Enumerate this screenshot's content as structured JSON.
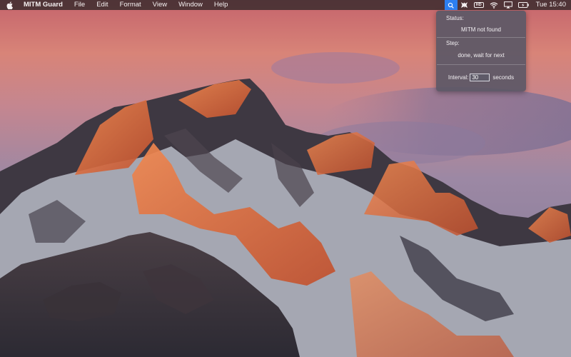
{
  "menubar": {
    "app_name": "MITM Guard",
    "menus": [
      "File",
      "Edit",
      "Format",
      "View",
      "Window",
      "Help"
    ],
    "status_icons": [
      "mitm-guard-icon",
      "bug-icon",
      "hd-icon",
      "wifi-icon",
      "airplay-icon",
      "battery-icon"
    ],
    "hd_badge": "HD",
    "clock": "Tue 15:40",
    "background_color": "#2e2628",
    "active_icon_color": "#2d7ff0"
  },
  "popover": {
    "status_label": "Status:",
    "status_value": "MITM not found",
    "step_label": "Step:",
    "step_value": "done, wait for next",
    "interval_label": "Interval:",
    "interval_value": "30",
    "interval_unit": "seconds"
  }
}
